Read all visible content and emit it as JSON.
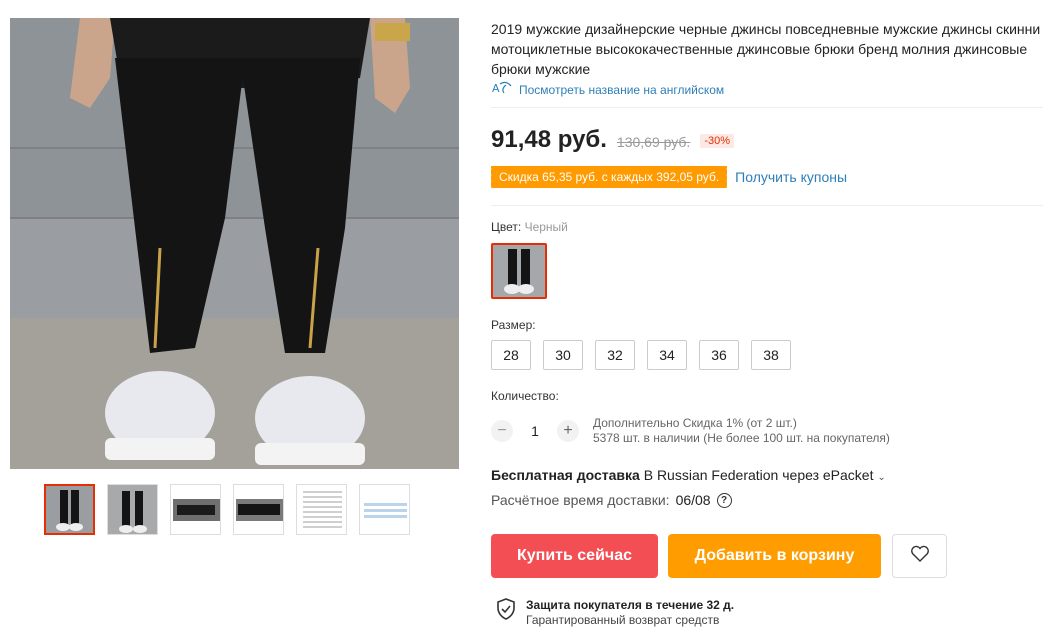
{
  "product": {
    "title": "2019 мужские дизайнерские черные джинсы повседневные мужские джинсы скинни мотоциклетные высококачественные джинсовые брюки бренд молния джинсовые брюки мужские",
    "translate_link": "Посмотреть название на английском",
    "price": "91,48 руб.",
    "old_price": "130,69 руб.",
    "discount": "-30%",
    "coupon": "Скидка 65,35 руб. с каждых 392,05 руб.",
    "coupon_link": "Получить купоны"
  },
  "color": {
    "label": "Цвет:",
    "selected": "Черный"
  },
  "size": {
    "label": "Размер:",
    "options": [
      "28",
      "30",
      "32",
      "34",
      "36",
      "38"
    ]
  },
  "quantity": {
    "label": "Количество:",
    "minus": "−",
    "value": "1",
    "plus": "+",
    "extra_discount": "Дополнительно Скидка 1% (от 2 шт.)",
    "stock": "5378 шт. в наличии (Не более 100 шт. на покупателя)"
  },
  "shipping": {
    "free": "Бесплатная доставка",
    "details": " В Russian Federation через ePacket",
    "eta_label": "Расчётное время доставки:",
    "eta_value": "06/08"
  },
  "actions": {
    "buy": "Купить сейчас",
    "cart": "Добавить в корзину"
  },
  "protection": {
    "title": "Защита покупателя в течение 32 д.",
    "subtitle": "Гарантированный возврат средств"
  },
  "colors": {
    "accent_red": "#f44e55",
    "accent_orange": "#ff9c00",
    "link_blue": "#2e7fb8"
  }
}
